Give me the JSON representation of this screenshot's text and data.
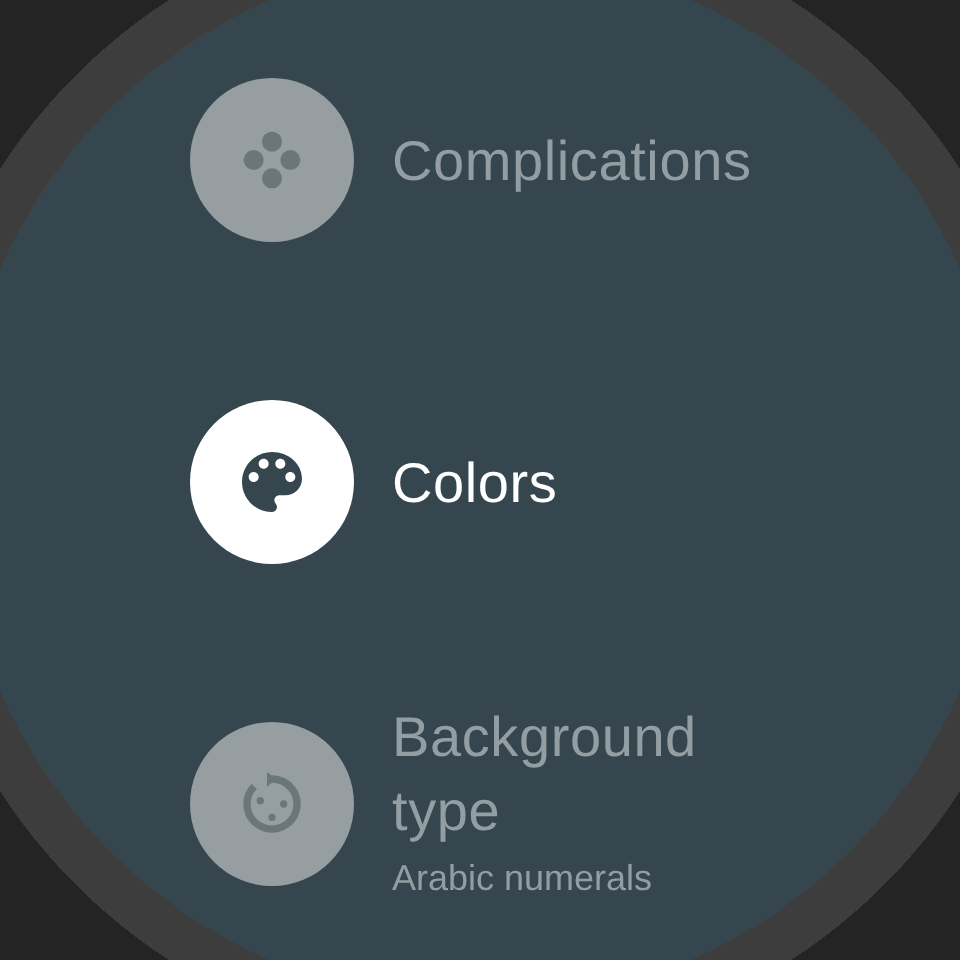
{
  "menu": [
    {
      "title": "Complications",
      "selected": false
    },
    {
      "title": "Colors",
      "selected": true
    },
    {
      "title": "Background type",
      "subtitle": "Arabic numerals",
      "selected": false
    }
  ]
}
